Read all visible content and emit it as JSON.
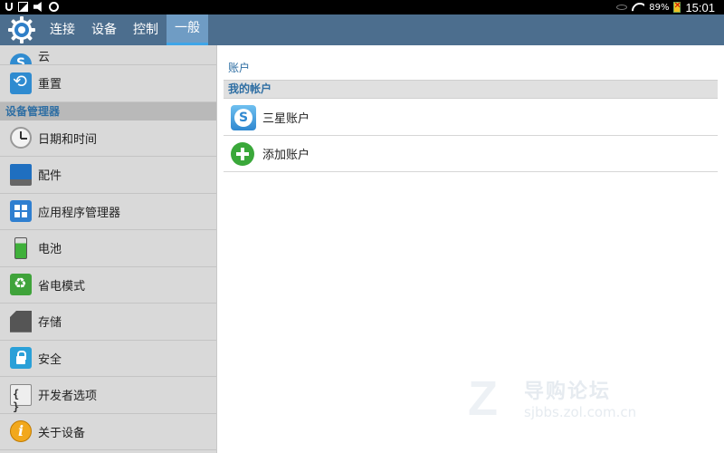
{
  "status_bar": {
    "battery_percent": "89%",
    "time": "15:01",
    "icons": [
      "usb-icon",
      "image-icon",
      "mute-icon",
      "chat-icon",
      "eye-icon",
      "wifi-icon",
      "battery-icon"
    ]
  },
  "tabs": [
    {
      "label": "连接",
      "active": false
    },
    {
      "label": "设备",
      "active": false
    },
    {
      "label": "控制",
      "active": false
    },
    {
      "label": "一般",
      "active": true
    }
  ],
  "sidebar": {
    "top_items": [
      {
        "label": "云",
        "icon": "cloud-icon"
      },
      {
        "label": "重置",
        "icon": "reset-icon"
      }
    ],
    "section_header": "设备管理器",
    "items": [
      {
        "label": "日期和时间",
        "icon": "clock-icon"
      },
      {
        "label": "配件",
        "icon": "accessory-icon"
      },
      {
        "label": "应用程序管理器",
        "icon": "apps-grid-icon"
      },
      {
        "label": "电池",
        "icon": "battery-icon"
      },
      {
        "label": "省电模式",
        "icon": "power-saving-icon"
      },
      {
        "label": "存储",
        "icon": "sd-card-icon"
      },
      {
        "label": "安全",
        "icon": "lock-icon"
      },
      {
        "label": "开发者选项",
        "icon": "braces-icon"
      },
      {
        "label": "关于设备",
        "icon": "info-icon"
      }
    ]
  },
  "main": {
    "breadcrumb": "账户",
    "category_header": "我的帐户",
    "rows": [
      {
        "label": "三星账户",
        "icon": "samsung-account-icon"
      },
      {
        "label": "添加账户",
        "icon": "add-icon"
      }
    ]
  },
  "watermark": {
    "logo": "Z",
    "text": "导购论坛",
    "url": "sjbbs.zol.com.cn"
  },
  "colors": {
    "tab_bar": "#4c6e8e",
    "tab_active": "#6f9cc4",
    "sidebar_bg": "#d9d9d9",
    "accent_text": "#2e6ea3"
  }
}
